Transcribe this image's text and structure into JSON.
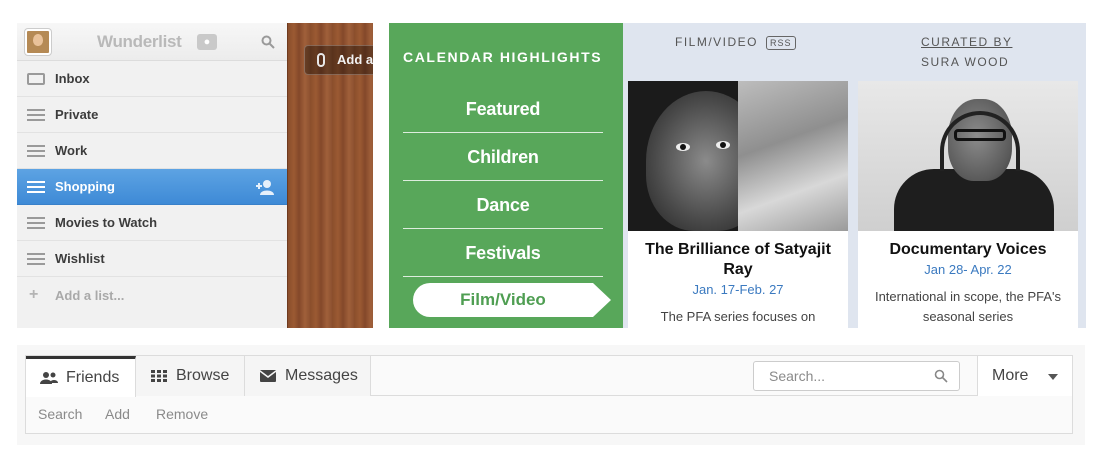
{
  "wunderlist": {
    "title": "Wunderlist",
    "lists": [
      {
        "label": "Inbox",
        "icon": "inbox-icon"
      },
      {
        "label": "Private",
        "icon": "list-icon"
      },
      {
        "label": "Work",
        "icon": "list-icon"
      },
      {
        "label": "Shopping",
        "icon": "list-icon",
        "active": true
      },
      {
        "label": "Movies to Watch",
        "icon": "list-icon"
      },
      {
        "label": "Wishlist",
        "icon": "list-icon"
      }
    ],
    "add_list": "Add a list...",
    "add_task": "Add a",
    "accent": "#4a94dc"
  },
  "calendar": {
    "nav_title": "CALENDAR HIGHLIGHTS",
    "nav_items": [
      "Featured",
      "Children",
      "Dance",
      "Festivals"
    ],
    "nav_active": "Film/Video",
    "section": "FILM/VIDEO",
    "rss": "RSS",
    "curated_label": "CURATED BY",
    "curator": "SURA WOOD",
    "cards": [
      {
        "title": "The Brilliance of Satyajit Ray",
        "date": "Jan. 17-Feb. 27",
        "desc": "The PFA series focuses on"
      },
      {
        "title": "Documentary Voices",
        "date": "Jan 28- Apr. 22",
        "desc": "International in scope, the PFA's seasonal series"
      }
    ],
    "accent": "#58a75a",
    "link_color": "#3b7ac0"
  },
  "tabbar": {
    "tabs": [
      {
        "label": "Friends",
        "icon": "friends-icon",
        "active": true
      },
      {
        "label": "Browse",
        "icon": "grid-icon"
      },
      {
        "label": "Messages",
        "icon": "envelope-icon"
      }
    ],
    "search_placeholder": "Search...",
    "more": "More",
    "sub_actions": [
      "Search",
      "Add",
      "Remove"
    ]
  }
}
